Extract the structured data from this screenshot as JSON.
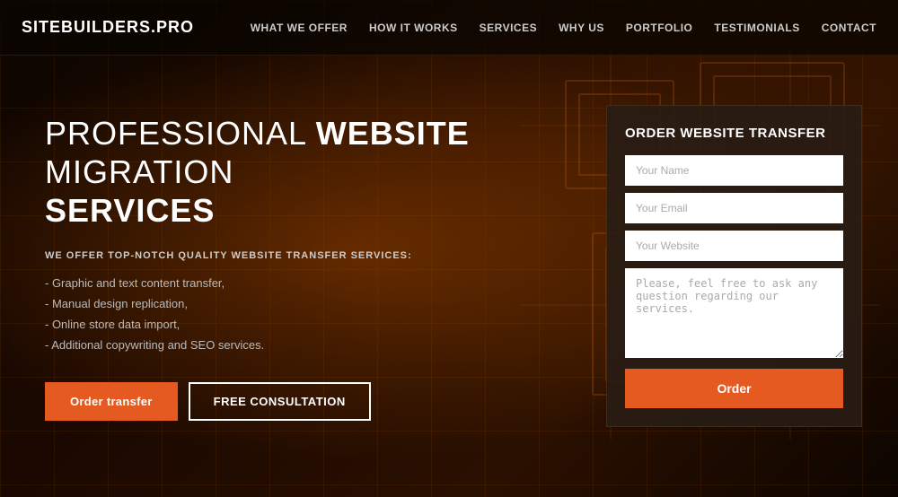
{
  "logo": {
    "text": "SITEBUILDERS.PRO"
  },
  "navbar": {
    "links": [
      {
        "id": "what-we-offer",
        "label": "WHAT WE OFFER"
      },
      {
        "id": "how-it-works",
        "label": "HOW IT WORKS"
      },
      {
        "id": "services",
        "label": "SERVICES"
      },
      {
        "id": "why-us",
        "label": "WHY US"
      },
      {
        "id": "portfolio",
        "label": "PORTFOLIO"
      },
      {
        "id": "testimonials",
        "label": "TESTIMONIALS"
      },
      {
        "id": "contact",
        "label": "CONTACT"
      }
    ]
  },
  "hero": {
    "title_part1": "PROFESSIONAL ",
    "title_bold": "WEBSITE",
    "title_part2": " MIGRATION",
    "title_line2": "SERVICES",
    "subtitle": "WE OFFER TOP-NOTCH QUALITY WEBSITE TRANSFER SERVICES:",
    "features": [
      "- Graphic and text content transfer,",
      "- Manual design replication,",
      "- Online store data import,",
      "- Additional copywriting and SEO services."
    ],
    "btn_order": "Order transfer",
    "btn_consultation": "FREE CONSULTATION"
  },
  "form": {
    "title": "ORDER WEBSITE TRANSFER",
    "name_placeholder": "Your Name",
    "email_placeholder": "Your Email",
    "website_placeholder": "Your Website",
    "message_placeholder": "Please, feel free to ask any question regarding our services.",
    "submit_label": "Order"
  }
}
